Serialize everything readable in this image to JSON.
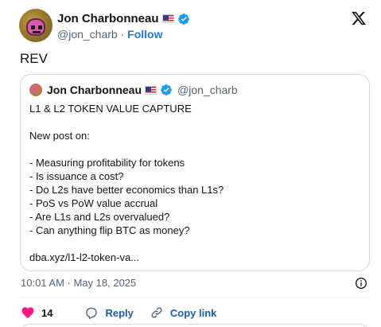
{
  "tweet": {
    "author": {
      "display_name": "Jon Charbonneau",
      "handle": "@jon_charb",
      "separator": "·",
      "follow_label": "Follow"
    },
    "text": "REV",
    "quote": {
      "display_name": "Jon Charbonneau",
      "handle": "@jon_charb",
      "lines": [
        "L1 & L2 TOKEN VALUE CAPTURE",
        "",
        "New post on:",
        "",
        "- Measuring profitability for tokens",
        "- Is issuance a cost?",
        "- Do L2s have better economics than L1s?",
        "- PoS vs PoW value accrual",
        "- Are L1s and L2s overvalued?",
        "- Can anything flip BTC as money?",
        "",
        "dba.xyz/l1-l2-token-va..."
      ]
    },
    "timestamp": "10:01 AM · May 18, 2025",
    "actions": {
      "like_count": "14",
      "reply_label": "Reply",
      "copy_label": "Copy link"
    }
  },
  "colors": {
    "accent": "#1d9bf0",
    "like": "#f91880",
    "muted": "#536471",
    "border": "#cfd9de"
  },
  "icons": [
    "x-logo-icon",
    "verified-badge-icon",
    "us-flag-icon",
    "info-icon",
    "heart-icon",
    "reply-icon",
    "link-icon"
  ]
}
